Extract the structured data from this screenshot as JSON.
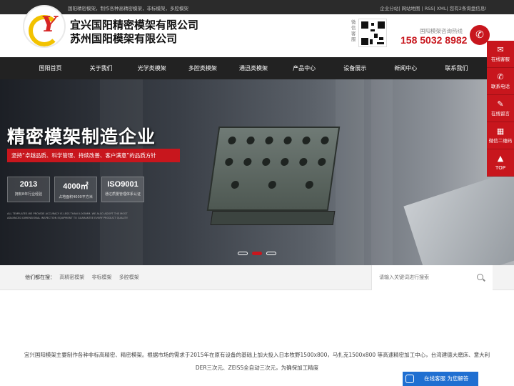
{
  "topbar": {
    "left_text": "国阳精密模架，制作各种高精密模架，非标模架，多腔模架",
    "right_text": "企业分站| 网站地图 | RSS| XML| 您有2条询盘信息!"
  },
  "header": {
    "company_line1": "宜兴国阳精密模架有限公司",
    "company_line2": "苏州国阳模架有限公司",
    "qr_label": "微信客服",
    "hotline_label": "国阳模架咨询热线",
    "hotline": "158 5032 8982"
  },
  "nav": {
    "items": [
      "国阳首页",
      "关于我们",
      "光学类模架",
      "多腔类模架",
      "通迅类模架",
      "产品中心",
      "设备展示",
      "新闻中心",
      "联系我们"
    ]
  },
  "banner": {
    "title": "精密模架制造企业",
    "slogan": "坚持“卓越品质、科学管理、持续改善、客户满意”的品质方针",
    "stats": [
      {
        "num": "2013",
        "desc": "拥有8年行业经验"
      },
      {
        "num": "4000㎡",
        "desc": "占地面积4000平方米"
      },
      {
        "num": "ISO9001",
        "desc": "通过质量管理体系认证"
      }
    ],
    "small_text": "ALL TEMPLATES WE PROVIDE ACCURACY IS LESS THAN 0.005MM. WE ALSO ADOPT THE MOST ADVANCED DIMENSIONAL INSPECTION EQUIPMENT TO GUARANTEE EVERY PRODUCT QUALITY.",
    "slide_count": 3,
    "active_slide": 2
  },
  "hotsearch": {
    "label": "他们都在搜：",
    "items": [
      "高精密模架",
      "非标模架",
      "多腔模架"
    ]
  },
  "search": {
    "placeholder": "请输入关键词进行搜索"
  },
  "intro": {
    "text": "宜兴国阳模架主要制作各种非标高精密、精密模架。根据市场的需求于2015年在原有设备的基础上加大投入日本牧野1500x800，马扎克1500x800 等高速精密加工中心，台湾建德大磨床、意大利DER三次元、ZEISS全自动三次元，为确保加工精度"
  },
  "side": {
    "items": [
      {
        "icon": "chat-icon",
        "label": "在线客服"
      },
      {
        "icon": "phone-icon",
        "label": "联系电话"
      },
      {
        "icon": "message-icon",
        "label": "在线留言"
      },
      {
        "icon": "qrcode-icon",
        "label": "微信二维码"
      },
      {
        "icon": "arrow-up-icon",
        "label": "TOP"
      }
    ]
  },
  "chat": {
    "label": "在线客服 为您解答"
  },
  "colors": {
    "accent": "#c8161d",
    "nav_bg": "#222222",
    "chat_blue": "#1f6fd1",
    "logo_yellow": "#f2c200"
  }
}
